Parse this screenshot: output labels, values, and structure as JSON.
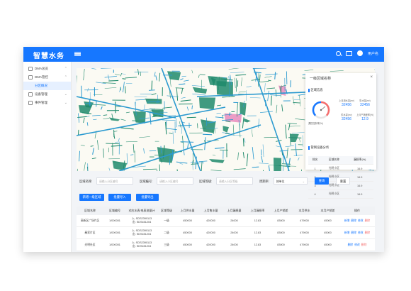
{
  "app": {
    "title": "智慧水务",
    "username": "用户名"
  },
  "sidebar": {
    "items": [
      {
        "label": "DMA总览",
        "expanded": true
      },
      {
        "label": "DMA管控",
        "expanded": true,
        "children": [
          {
            "label": "分区概况",
            "active": true
          }
        ]
      },
      {
        "label": "设备管理",
        "expanded": false
      },
      {
        "label": "事件管理",
        "expanded": false
      }
    ]
  },
  "panel": {
    "title": "一级区域名称",
    "close": "×",
    "section_info": "区域信息",
    "gauge_label": "漏损控制率(%)",
    "stats": [
      {
        "label": "上月用水量(m³)",
        "value": "32456"
      },
      {
        "label": "售水量(m³)",
        "value": "32456"
      },
      {
        "label": "供水量(m³)",
        "value": "32456"
      },
      {
        "label": "上月产销差率(%)",
        "value": "12.9"
      }
    ],
    "section_device": "管网设备分析",
    "table": {
      "headers": [
        "排名",
        "区域名称",
        "漏损率(%)"
      ],
      "rows": [
        [
          "1",
          "光明小区",
          "16.9"
        ],
        [
          "2",
          "光明小区",
          "16.9"
        ],
        [
          "3",
          "光明小区",
          "16.9"
        ],
        [
          "4",
          "光明小区",
          "16.9"
        ]
      ]
    }
  },
  "filters": {
    "area_name_label": "区域名称:",
    "area_name_placeholder": "请输入分区编号",
    "area_code_label": "区域编号:",
    "area_code_placeholder": "请输入小区编号",
    "area_level_label": "区域等级:",
    "area_level_placeholder": "请输入分区等级",
    "cycle_label": "周期率:",
    "cycle_value": "按单位",
    "query": "查询",
    "reset": "重置"
  },
  "actions": {
    "add": "新增一级区域",
    "import": "批量导入",
    "export": "批量导出"
  },
  "table": {
    "headers": [
      "区域名称",
      "区域编号",
      "对应水表/电表流量计",
      "区域等级",
      "上月供水量",
      "上月售水量",
      "上月漏损量",
      "上月漏损率",
      "上月产销差",
      "本月供水",
      "本月产销差",
      "操作"
    ],
    "rows": [
      {
        "name": "高新区广场片区",
        "code": "1/000001",
        "meter1": "入: SDS2390113",
        "meter2": "出: SDS451204",
        "level": "一级",
        "supply": "450000",
        "sold": "420000",
        "loss": "24000",
        "loss_rate": "12.83",
        "diff": "83000",
        "month_supply": "479000",
        "month_diff": "45000",
        "ops": [
          "新增",
          "删除",
          "修改",
          "删除"
        ]
      },
      {
        "name": "秦家片区",
        "code": "1/000001",
        "meter1": "入: SDS2390113",
        "meter2": "出: SDS451204",
        "level": "二级",
        "supply": "450000",
        "sold": "420000",
        "loss": "24000",
        "loss_rate": "12.83",
        "diff": "83000",
        "month_supply": "479000",
        "month_diff": "45000",
        "ops": [
          "新增",
          "删除",
          "修改",
          "删除"
        ]
      },
      {
        "name": "光明社区",
        "code": "1/000001",
        "meter1": "入: SDS2390113",
        "meter2": "出: SDS451204",
        "level": "三级",
        "supply": "450000",
        "sold": "420000",
        "loss": "24000",
        "loss_rate": "12.83",
        "diff": "83000",
        "month_supply": "479000",
        "month_diff": "45000",
        "ops": [
          "删除",
          "修改",
          "删除"
        ]
      }
    ]
  },
  "colors": {
    "primary": "#1677ff",
    "danger": "#f56c6c",
    "map_road": "#2b9ad0",
    "map_park": "#1f8a6b",
    "map_pink": "#e88bbd"
  }
}
